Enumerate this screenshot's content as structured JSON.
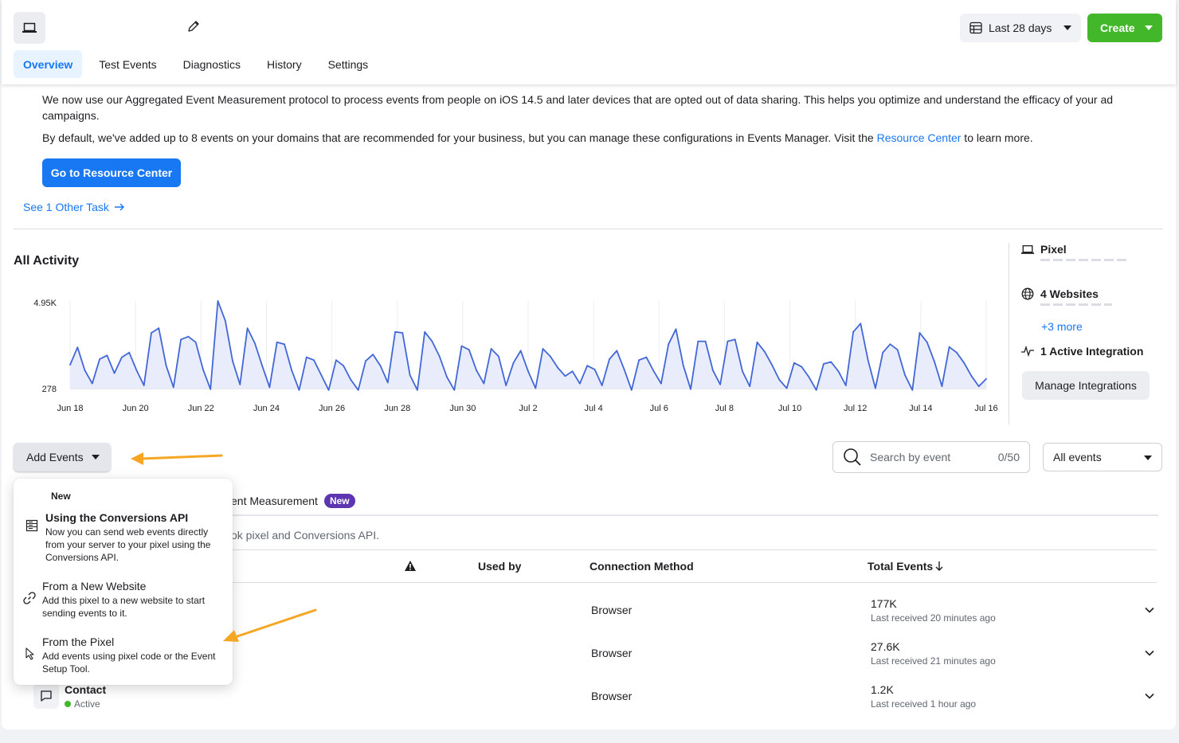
{
  "header": {
    "tabs": [
      "Overview",
      "Test Events",
      "Diagnostics",
      "History",
      "Settings"
    ],
    "active_tab": "Overview",
    "date_range": "Last 28 days",
    "create_label": "Create"
  },
  "notice": {
    "line1": "We now use our Aggregated Event Measurement protocol to process events from people on iOS 14.5 and later devices that are opted out of data sharing. This helps you optimize and understand the efficacy of your ad campaigns.",
    "line2_before": "By default, we've added up to 8 events on your domains that are recommended for your business, but you can manage these configurations in Events Manager. Visit the ",
    "line2_link": "Resource Center",
    "line2_after": " to learn more.",
    "button": "Go to Resource Center",
    "other_task": "See 1 Other Task"
  },
  "activity": {
    "title": "All Activity"
  },
  "chart_data": {
    "type": "area",
    "y_tick_labels": [
      "4.95K",
      "278"
    ],
    "ylim": [
      278,
      4950
    ],
    "x_tick_labels": [
      "Jun 18",
      "Jun 20",
      "Jun 22",
      "Jun 24",
      "Jun 26",
      "Jun 28",
      "Jun 30",
      "Jul 2",
      "Jul 4",
      "Jul 6",
      "Jul 8",
      "Jul 10",
      "Jul 12",
      "Jul 14",
      "Jul 16"
    ],
    "values": [
      1550,
      2480,
      1250,
      550,
      1850,
      2050,
      1100,
      1950,
      2200,
      1250,
      450,
      3250,
      3500,
      1500,
      350,
      2900,
      3050,
      2750,
      1300,
      250,
      4950,
      3900,
      1750,
      500,
      3500,
      2700,
      1500,
      350,
      2750,
      2650,
      1250,
      200,
      1950,
      1800,
      1000,
      200,
      1800,
      1500,
      750,
      200,
      1750,
      2100,
      1500,
      600,
      3300,
      3250,
      1000,
      200,
      3300,
      2800,
      2000,
      900,
      200,
      2550,
      2350,
      1250,
      550,
      2400,
      2000,
      450,
      1650,
      2300,
      1200,
      300,
      2400,
      2000,
      1400,
      950,
      1200,
      550,
      1500,
      1300,
      450,
      1850,
      2300,
      1300,
      200,
      1800,
      1950,
      1200,
      550,
      2650,
      3450,
      1500,
      250,
      2800,
      2800,
      1250,
      500,
      2800,
      2900,
      1200,
      400,
      2750,
      2250,
      1550,
      750,
      300,
      1650,
      1450,
      900,
      200,
      1600,
      1700,
      1200,
      450,
      3300,
      3750,
      1800,
      300,
      2200,
      2650,
      2350,
      1000,
      200,
      3250,
      2750,
      1700,
      400,
      2500,
      2200,
      1650,
      950,
      400,
      800
    ],
    "grid": true
  },
  "sidebar": {
    "pixel_label": "Pixel",
    "websites_label": "4 Websites",
    "more_link": "+3 more",
    "integration_label": "1 Active Integration",
    "manage_button": "Manage Integrations"
  },
  "controls": {
    "add_events": "Add Events",
    "search_placeholder": "Search by event",
    "search_count": "0/50",
    "filter_value": "All events"
  },
  "dropdown": {
    "new_tag": "New",
    "items": [
      {
        "title": "Using the Conversions API",
        "desc_lines": [
          "Now you can send web events directly",
          "from your server to your pixel using the",
          "Conversions API."
        ],
        "icon": "server-icon"
      },
      {
        "title": "From a New Website",
        "desc_lines": [
          "Add this pixel to a new website to start",
          "sending events to it."
        ],
        "icon": "link-icon"
      },
      {
        "title": "From the Pixel",
        "desc_lines": [
          "Add events using pixel code or the Event",
          "Setup Tool."
        ],
        "icon": "cursor-icon"
      }
    ]
  },
  "events_section": {
    "aem_tab": "ent Measurement",
    "aem_badge": "New",
    "description": "ok pixel and Conversions API.",
    "headers": {
      "used_by": "Used by",
      "connection": "Connection Method",
      "total": "Total Events"
    },
    "rows": [
      {
        "name": "",
        "status": "",
        "connection": "Browser",
        "total": "177K",
        "last": "Last received 20 minutes ago"
      },
      {
        "name": "",
        "status": "",
        "connection": "Browser",
        "total": "27.6K",
        "last": "Last received 21 minutes ago"
      },
      {
        "name": "Contact",
        "status": "Active",
        "connection": "Browser",
        "total": "1.2K",
        "last": "Last received 1 hour ago"
      }
    ]
  },
  "colors": {
    "accent": "#1877f2",
    "create_green": "#42b72a",
    "annotation_arrow": "#f5a623",
    "chart_line": "#4267d6"
  }
}
